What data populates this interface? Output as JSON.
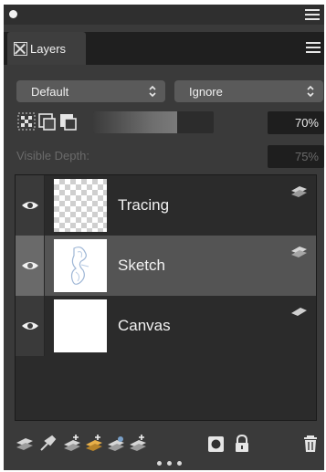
{
  "panel": {
    "tab_label": "Layers"
  },
  "controls": {
    "composite_method": "Default",
    "composite_depth": "Ignore",
    "opacity_value": "70%",
    "opacity_fraction": 0.7,
    "visible_depth_label": "Visible Depth:",
    "visible_depth_value": "75%"
  },
  "layers": [
    {
      "name": "Tracing",
      "thumbnail": "transparent",
      "visible": true,
      "selected": false,
      "icon": "layer-stack-icon"
    },
    {
      "name": "Sketch",
      "thumbnail": "sketch",
      "visible": true,
      "selected": true,
      "icon": "layer-stack-icon"
    },
    {
      "name": "Canvas",
      "thumbnail": "white",
      "visible": true,
      "selected": false,
      "icon": "canvas-layer-icon"
    }
  ],
  "footer_icons": [
    "layer-commands-icon",
    "dynamic-plugins-icon",
    "new-layer-icon",
    "new-watercolor-layer-icon",
    "new-liquid-ink-layer-icon",
    "new-thick-paint-layer-icon",
    "create-mask-icon",
    "lock-icon",
    "delete-icon"
  ],
  "colors": {
    "panel_bg": "#3a3a3a",
    "selected_row": "#545454",
    "list_bg": "#2b2b2b"
  }
}
